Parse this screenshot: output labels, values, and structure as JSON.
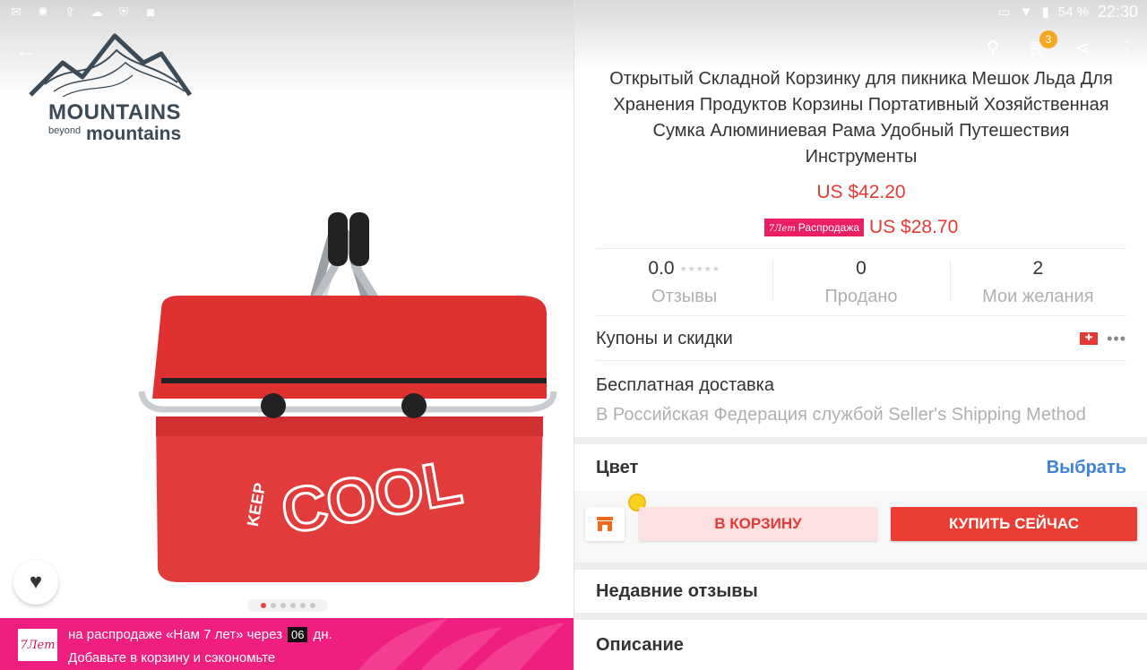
{
  "status_bar": {
    "battery": "54 %",
    "time": "22:30"
  },
  "brand": {
    "name_line1": "MOUNTAINS",
    "name_small": "beyond",
    "name_line2": "mountains"
  },
  "cart": {
    "count": "3"
  },
  "product": {
    "title": "Открытый Складной Корзинку для пикника Мешок Льда Для Хранения Продуктов Корзины Портативный Хозяйственная Сумка Алюминиевая Рама Удобный Путешествия Инструменты",
    "price_original": "US $42.20",
    "sale_badge_prefix": "7Лет",
    "sale_badge_text": "Распродажа",
    "price_sale": "US $28.70"
  },
  "stats": [
    {
      "value": "0.0",
      "label": "Отзывы"
    },
    {
      "value": "0",
      "label": "Продано"
    },
    {
      "value": "2",
      "label": "Мои желания"
    }
  ],
  "coupons": {
    "title": "Купоны и скидки"
  },
  "shipping": {
    "title": "Бесплатная доставка",
    "subtitle": "В Российская Федерация службой Seller's Shipping Method"
  },
  "color": {
    "label": "Цвет",
    "action": "Выбрать"
  },
  "actions": {
    "add_to_cart": "В КОРЗИНУ",
    "buy_now": "КУПИТЬ СЕЙЧАС"
  },
  "sections": {
    "recent_reviews": "Недавние отзывы",
    "description": "Описание"
  },
  "promo": {
    "logo_text": "7Лет",
    "line1_prefix": "на распродаже «Нам 7 лет» через",
    "days": "06",
    "line1_suffix": "дн.",
    "line2": "Добавьте в корзину и сэкономьте"
  },
  "image_dots": {
    "count": 6,
    "active": 0
  },
  "colors": {
    "accent_red": "#e53935",
    "link_blue": "#3e83d6",
    "promo_pink": "#ee1f7f"
  }
}
